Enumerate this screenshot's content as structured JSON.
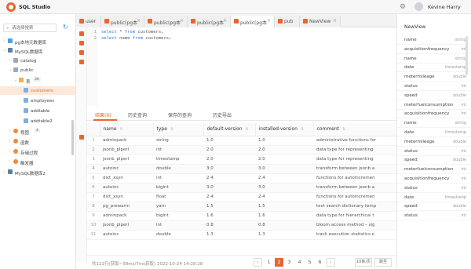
{
  "app": {
    "title": "SQL Studio",
    "user": "Kevine Harry"
  },
  "sidebar": {
    "search_placeholder": "请选择搜索",
    "tree": [
      {
        "label": "pg本地元数据库",
        "icon": "database-icon"
      },
      {
        "label": "MySQL数据库",
        "icon": "mysql-icon"
      },
      {
        "label": "catalog",
        "icon": "schema-icon"
      },
      {
        "label": "public",
        "icon": "schema-icon"
      },
      {
        "label": "表",
        "icon": "folder-icon",
        "badge": "36"
      },
      {
        "label": "customers",
        "icon": "table-icon"
      },
      {
        "label": "employees",
        "icon": "table-icon"
      },
      {
        "label": "addtable",
        "icon": "table-icon"
      },
      {
        "label": "addtable2",
        "icon": "table-icon"
      },
      {
        "label": "视图",
        "icon": "view-icon",
        "badge": "4"
      },
      {
        "label": "函数",
        "icon": "function-icon"
      },
      {
        "label": "存储过程",
        "icon": "procedure-icon"
      },
      {
        "label": "触发器",
        "icon": "trigger-icon"
      },
      {
        "label": "MySQL数据库2",
        "icon": "mysql-icon"
      }
    ]
  },
  "tabs": [
    {
      "label": "user"
    },
    {
      "label": "public(pg本..."
    },
    {
      "label": "public(pg本..."
    },
    {
      "label": "public(pg本..."
    },
    {
      "label": "public(pg本..."
    },
    {
      "label": "pub"
    },
    {
      "label": "NewView"
    }
  ],
  "editor": {
    "lines": [
      {
        "n": "1",
        "kw1": "select",
        "mid": " * ",
        "kw2": "from",
        "rest": " customers;"
      },
      {
        "n": "2",
        "kw1": "select",
        "mid": " name ",
        "kw2": "from",
        "rest": " customers;"
      }
    ]
  },
  "result_tabs": [
    "结果(6)",
    "历史查询",
    "保存的查询",
    "历史导出"
  ],
  "table": {
    "columns": [
      "name",
      "type",
      "default-version",
      "installed-version",
      "comment"
    ],
    "rows": [
      [
        "1",
        "adminpack",
        "string",
        "1.0",
        "1.0",
        "administrative functions for"
      ],
      [
        "2",
        "jsonb_plperl",
        "int",
        "2.0",
        "2.0",
        "data type for representing"
      ],
      [
        "3",
        "jsonb_plperl",
        "timestamp",
        "2.0",
        "2.0",
        "data type for representing"
      ],
      [
        "4",
        "autoinc",
        "double",
        "3.0",
        "3.0",
        "transform between jsonb a"
      ],
      [
        "5",
        "dict_xsyn",
        "int",
        "2.4",
        "2.4",
        "functions for autoincremen"
      ],
      [
        "6",
        "autoinc",
        "bigint",
        "3.0",
        "3.0",
        "transform between jsonb a"
      ],
      [
        "7",
        "dict_xsyn",
        "float",
        "2.4",
        "2.4",
        "functions for autoincremen"
      ],
      [
        "8",
        "pg_prewarm",
        "yarn",
        "1.5",
        "1.5",
        "text search dictionary temp"
      ],
      [
        "9",
        "adminpack",
        "bigint",
        "1.6",
        "1.6",
        "data type for hierarchical t"
      ],
      [
        "10",
        "jsonb_plperl",
        "int",
        "0.8",
        "0.8",
        "bloom access method – sig"
      ],
      [
        "11",
        "autoinc",
        "double",
        "1.3",
        "1.3",
        "track execution statistics o"
      ]
    ]
  },
  "footer": {
    "status": "共121行(获取~58ms/7ms获取) 2022-10-24 14:28:28",
    "pages": [
      "1",
      "2",
      "3",
      "4",
      "5",
      "6"
    ],
    "active_page": "2",
    "page_size": "10条/页",
    "jump": "跳至"
  },
  "right_panel": {
    "title": "NewView",
    "fields": [
      {
        "name": "name",
        "type": "string"
      },
      {
        "name": "acquisitionfrequency",
        "type": "int"
      },
      {
        "name": "name",
        "type": "string"
      },
      {
        "name": "date",
        "type": "timestamp"
      },
      {
        "name": "metermileage",
        "type": "double"
      },
      {
        "name": "status",
        "type": "int"
      },
      {
        "name": "speed",
        "type": "double"
      },
      {
        "name": "meterfuelconsumption",
        "type": "int"
      },
      {
        "name": "acquisitionfrequency",
        "type": "int"
      },
      {
        "name": "name",
        "type": "string"
      },
      {
        "name": "date",
        "type": "timestamp"
      },
      {
        "name": "metermileage",
        "type": "double"
      },
      {
        "name": "status",
        "type": "int"
      },
      {
        "name": "speed",
        "type": "double"
      },
      {
        "name": "meterfuelconsumption",
        "type": "int"
      },
      {
        "name": "acquisitionfrequency",
        "type": "int"
      },
      {
        "name": "status",
        "type": "int"
      },
      {
        "name": "date",
        "type": "timestamp"
      },
      {
        "name": "speed",
        "type": "double"
      },
      {
        "name": "status",
        "type": "int"
      }
    ]
  }
}
